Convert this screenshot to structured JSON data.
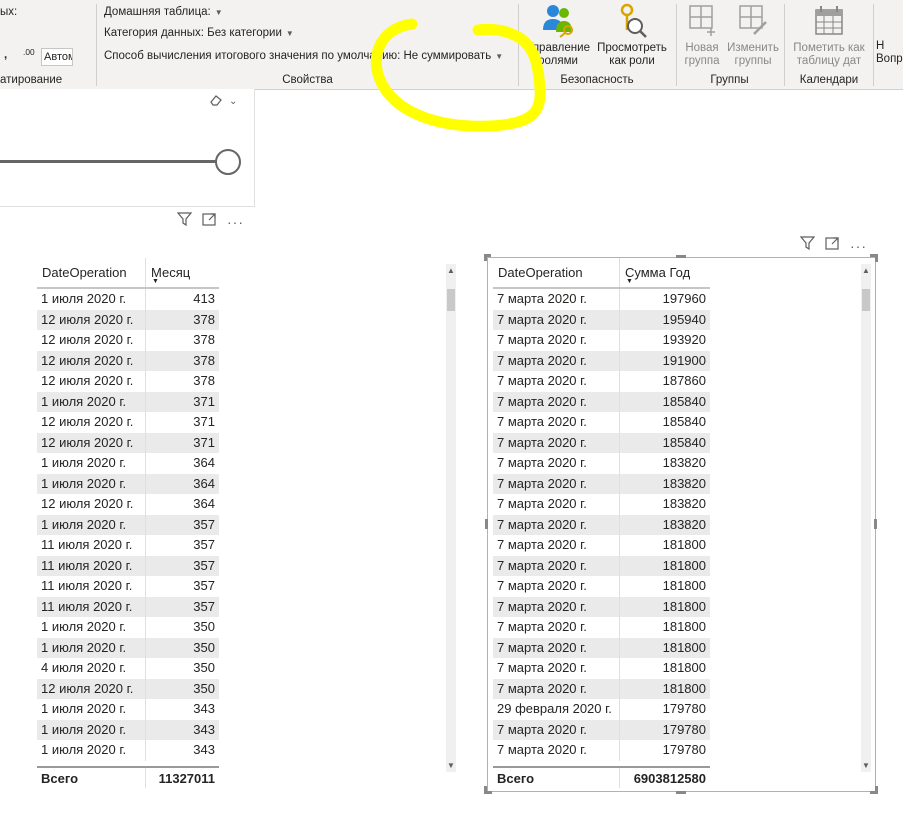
{
  "ribbon": {
    "partial_top_label": "ых:",
    "autofield_value": "Автом",
    "format_group_label": "атирование",
    "home_table_label": "Домашняя таблица:",
    "data_category_label": "Категория данных: Без категории",
    "summarization_label": "Способ вычисления итогового значения по умолчанию: Не суммировать",
    "properties_group_label": "Свойства",
    "security_group_label": "Безопасность",
    "groups_group_label": "Группы",
    "calendars_group_label": "Календари",
    "buttons": {
      "manage_roles": "Управление\nролями",
      "view_as_roles": "Просмотреть\nкак роли",
      "new_group": "Новая\nгруппа",
      "edit_groups": "Изменить\nгруппы",
      "mark_date_table": "Пометить как\nтаблицу дат",
      "qa_partial": "Н\nВопро"
    }
  },
  "left_table": {
    "col1_header": "DateOperation",
    "col2_header": "Месяц",
    "rows": [
      [
        "1 июля 2020 г.",
        "413"
      ],
      [
        "12 июля 2020 г.",
        "378"
      ],
      [
        "12 июля 2020 г.",
        "378"
      ],
      [
        "12 июля 2020 г.",
        "378"
      ],
      [
        "12 июля 2020 г.",
        "378"
      ],
      [
        "1 июля 2020 г.",
        "371"
      ],
      [
        "12 июля 2020 г.",
        "371"
      ],
      [
        "12 июля 2020 г.",
        "371"
      ],
      [
        "1 июля 2020 г.",
        "364"
      ],
      [
        "1 июля 2020 г.",
        "364"
      ],
      [
        "12 июля 2020 г.",
        "364"
      ],
      [
        "1 июля 2020 г.",
        "357"
      ],
      [
        "11 июля 2020 г.",
        "357"
      ],
      [
        "11 июля 2020 г.",
        "357"
      ],
      [
        "11 июля 2020 г.",
        "357"
      ],
      [
        "11 июля 2020 г.",
        "357"
      ],
      [
        "1 июля 2020 г.",
        "350"
      ],
      [
        "1 июля 2020 г.",
        "350"
      ],
      [
        "4 июля 2020 г.",
        "350"
      ],
      [
        "12 июля 2020 г.",
        "350"
      ],
      [
        "1 июля 2020 г.",
        "343"
      ],
      [
        "1 июля 2020 г.",
        "343"
      ],
      [
        "1 июля 2020 г.",
        "343"
      ]
    ],
    "total_label": "Всего",
    "total_value": "11327011"
  },
  "right_table": {
    "col1_header": "DateOperation",
    "col2_header": "Сумма Год",
    "rows": [
      [
        "7 марта 2020 г.",
        "197960"
      ],
      [
        "7 марта 2020 г.",
        "195940"
      ],
      [
        "7 марта 2020 г.",
        "193920"
      ],
      [
        "7 марта 2020 г.",
        "191900"
      ],
      [
        "7 марта 2020 г.",
        "187860"
      ],
      [
        "7 марта 2020 г.",
        "185840"
      ],
      [
        "7 марта 2020 г.",
        "185840"
      ],
      [
        "7 марта 2020 г.",
        "185840"
      ],
      [
        "7 марта 2020 г.",
        "183820"
      ],
      [
        "7 марта 2020 г.",
        "183820"
      ],
      [
        "7 марта 2020 г.",
        "183820"
      ],
      [
        "7 марта 2020 г.",
        "183820"
      ],
      [
        "7 марта 2020 г.",
        "181800"
      ],
      [
        "7 марта 2020 г.",
        "181800"
      ],
      [
        "7 марта 2020 г.",
        "181800"
      ],
      [
        "7 марта 2020 г.",
        "181800"
      ],
      [
        "7 марта 2020 г.",
        "181800"
      ],
      [
        "7 марта 2020 г.",
        "181800"
      ],
      [
        "7 марта 2020 г.",
        "181800"
      ],
      [
        "7 марта 2020 г.",
        "181800"
      ],
      [
        "29 февраля 2020 г.",
        "179780"
      ],
      [
        "7 марта 2020 г.",
        "179780"
      ],
      [
        "7 марта 2020 г.",
        "179780"
      ]
    ],
    "total_label": "Всего",
    "total_value": "6903812580"
  },
  "colors": {
    "ribbon_bg": "#f3f2f1",
    "highlight": "#ffff00",
    "row_alt": "#eaeaea",
    "icon_blue": "#2b88d8",
    "icon_gold": "#d9a400"
  }
}
